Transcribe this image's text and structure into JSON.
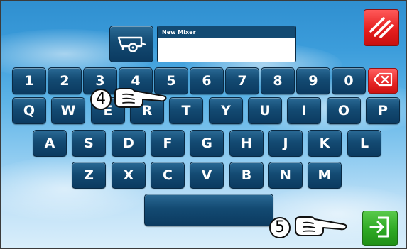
{
  "screen": {
    "field_label": "New Mixer",
    "field_value": ""
  },
  "keyboard": {
    "row1": [
      "1",
      "2",
      "3",
      "4",
      "5",
      "6",
      "7",
      "8",
      "9",
      "0"
    ],
    "row2": [
      "Q",
      "W",
      "E",
      "R",
      "T",
      "Y",
      "U",
      "I",
      "O",
      "P"
    ],
    "row3": [
      "A",
      "S",
      "D",
      "F",
      "G",
      "H",
      "J",
      "K",
      "L"
    ],
    "row4": [
      "Z",
      "X",
      "C",
      "V",
      "B",
      "N",
      "M"
    ],
    "space_label": ""
  },
  "icons": {
    "trailer": "trailer-icon",
    "cancel": "cancel-icon",
    "backspace": "backspace-icon",
    "enter": "enter-icon",
    "pointer": "pointing-hand-icon"
  },
  "callouts": {
    "step_4": "4",
    "step_5": "5"
  },
  "colors": {
    "key_dark": "#0b3a60",
    "cancel_red": "#e51f1f",
    "enter_green": "#2ea823"
  }
}
